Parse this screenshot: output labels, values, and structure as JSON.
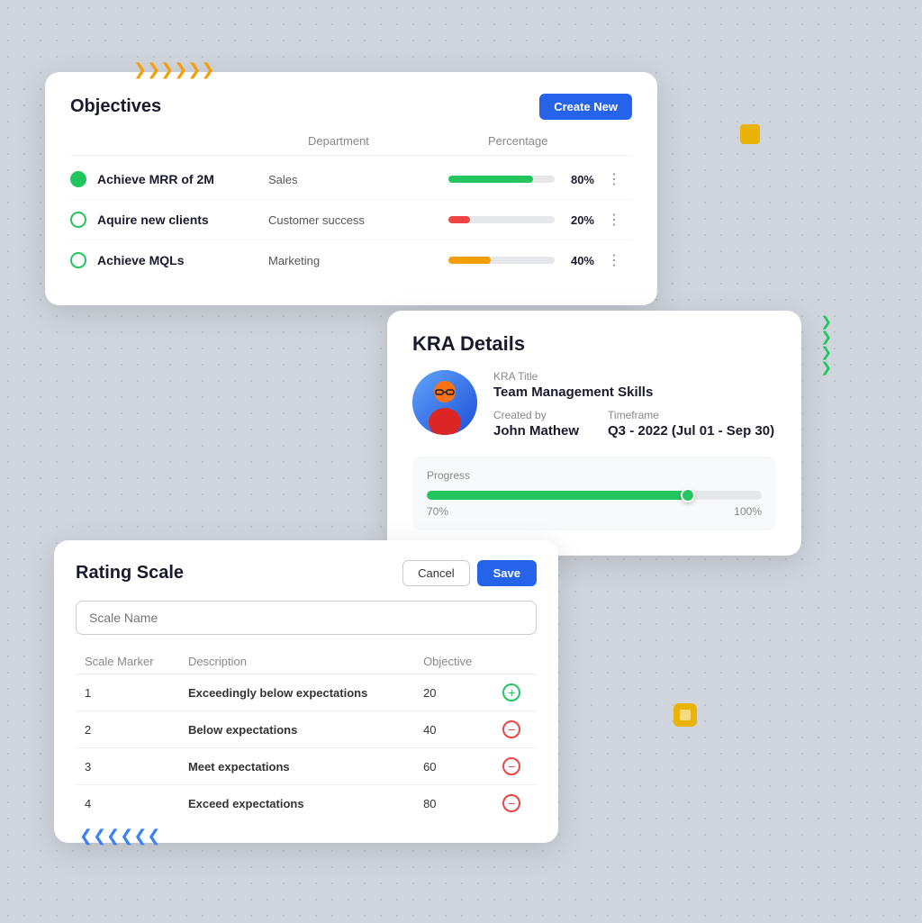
{
  "objectives": {
    "title": "Objectives",
    "create_btn": "Create New",
    "col_department": "Department",
    "col_percentage": "Percentage",
    "rows": [
      {
        "name": "Achieve MRR of 2M",
        "department": "Sales",
        "percentage": "80%",
        "progress": 80,
        "color": "#22c55e",
        "dot_filled": true
      },
      {
        "name": "Aquire new clients",
        "department": "Customer success",
        "percentage": "20%",
        "progress": 20,
        "color": "#ef4444",
        "dot_filled": false
      },
      {
        "name": "Achieve MQLs",
        "department": "Marketing",
        "percentage": "40%",
        "progress": 40,
        "color": "#f59e0b",
        "dot_filled": false
      }
    ]
  },
  "kra": {
    "title": "KRA Details",
    "kra_title_label": "KRA Title",
    "kra_title_value": "Team Management Skills",
    "created_by_label": "Created by",
    "created_by_value": "John Mathew",
    "timeframe_label": "Timeframe",
    "timeframe_value": "Q3 - 2022  (Jul 01 - Sep 30)",
    "progress_label": "Progress",
    "progress_value": 78,
    "progress_start": "70%",
    "progress_end": "100%"
  },
  "rating": {
    "title": "Rating Scale",
    "cancel_label": "Cancel",
    "save_label": "Save",
    "scale_name_placeholder": "Scale Name",
    "col_marker": "Scale Marker",
    "col_description": "Description",
    "col_objective": "Objective",
    "rows": [
      {
        "marker": "1",
        "description": "Exceedingly below expectations",
        "objective": "20",
        "action": "add"
      },
      {
        "marker": "2",
        "description": "Below expectations",
        "objective": "40",
        "action": "remove"
      },
      {
        "marker": "3",
        "description": "Meet expectations",
        "objective": "60",
        "action": "remove"
      },
      {
        "marker": "4",
        "description": "Exceed expectations",
        "objective": "80",
        "action": "remove"
      }
    ]
  },
  "decorations": {
    "yellow_box": "#eab308",
    "blue_arrows": "<<<<<<",
    "yellow_arrows": ">>>>>>",
    "green_arrows": "vvvv"
  }
}
